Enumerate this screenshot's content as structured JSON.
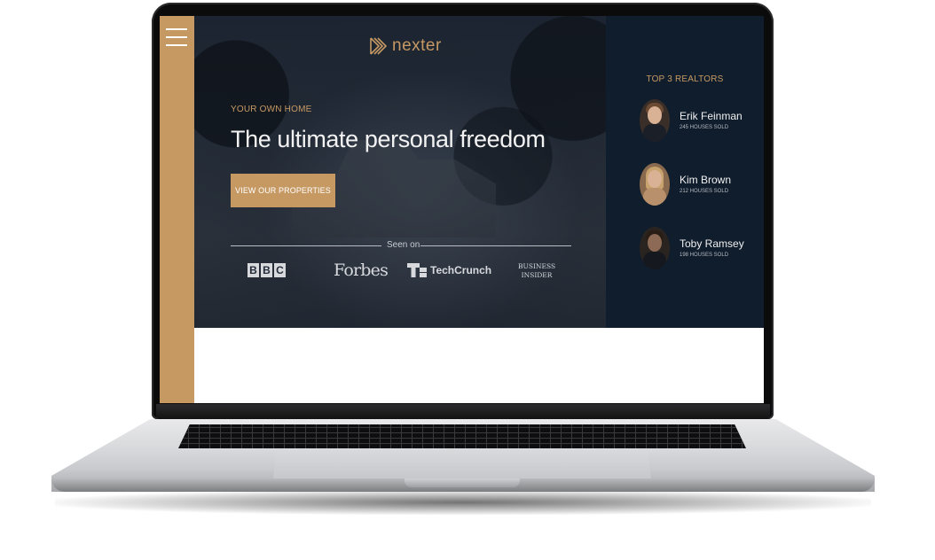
{
  "site": {
    "logo_text": "nexter",
    "hero": {
      "subtitle": "YOUR OWN HOME",
      "title": "The ultimate personal freedom",
      "cta_label": "VIEW OUR PROPERTIES",
      "seen_on": "Seen on"
    },
    "press": {
      "bbc_letters": [
        "B",
        "B",
        "C"
      ],
      "forbes": "Forbes",
      "techcrunch": "TechCrunch",
      "business_insider_line1": "BUSINESS",
      "business_insider_line2": "INSIDER"
    },
    "realtors": {
      "title": "TOP 3 REALTORS",
      "items": [
        {
          "name": "Erik Feinman",
          "sold": "245 HOUSES SOLD"
        },
        {
          "name": "Kim Brown",
          "sold": "212 HOUSES SOLD"
        },
        {
          "name": "Toby Ramsey",
          "sold": "198 HOUSES SOLD"
        }
      ]
    }
  },
  "colors": {
    "primary": "#c69963",
    "dark": "#101d2c",
    "hero_overlay": "#1c2431",
    "white": "#ffffff"
  },
  "icons": {
    "menu": "hamburger-icon",
    "logo": "nexter-logo-icon",
    "techcrunch": "techcrunch-logo-icon"
  }
}
